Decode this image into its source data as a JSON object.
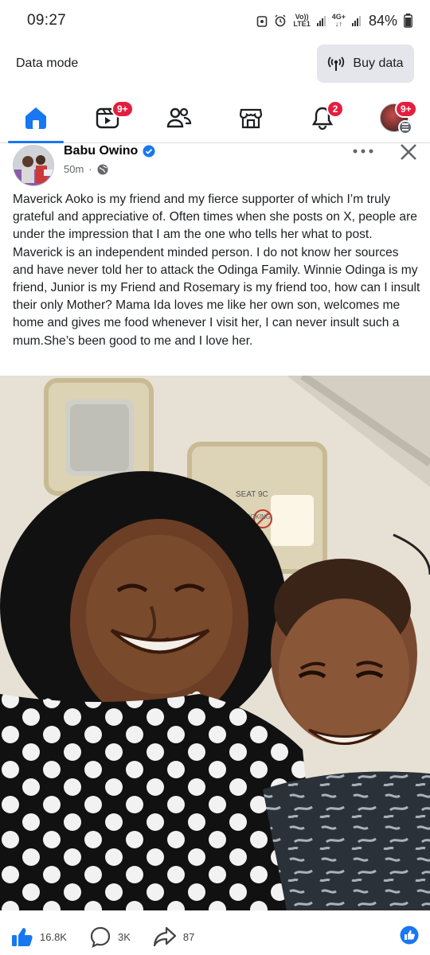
{
  "status_bar": {
    "time": "09:27",
    "volte_label": "Vo))",
    "lte_label": "LTE1",
    "network_label": "4G+",
    "battery_percent": "84%"
  },
  "data_mode": {
    "label": "Data mode",
    "button_label": "Buy data"
  },
  "nav": {
    "tabs": [
      {
        "name": "home",
        "active": true
      },
      {
        "name": "video",
        "badge": "9+"
      },
      {
        "name": "friends"
      },
      {
        "name": "marketplace"
      },
      {
        "name": "notifications",
        "badge": "2"
      },
      {
        "name": "menu",
        "badge": "9+"
      }
    ]
  },
  "post": {
    "author": "Babu Owino",
    "verified": true,
    "time_ago": "50m",
    "audience_icon": "globe-icon",
    "text": "Maverick Aoko is my friend and my fierce supporter of which I’m truly grateful and appreciative of. Often times when she posts on X, people are under the impression that I am the one who tells her what to post. Maverick is an independent minded person. I do not know her sources and have never told her to attack the Odinga Family. Winnie Odinga is my friend, Junior is my Friend and Rosemary is my friend too, how can I insult their only Mother? Mama Ida loves me like her own son, welcomes me home and gives me food whenever I visit her, I can never insult such a mum.She’s been good to me and I love her.",
    "photo_signs": {
      "seat": "SEAT 9C",
      "no_smoking": "NO SMOKING"
    }
  },
  "reactions": {
    "likes": "16.8K",
    "comments": "3K",
    "shares": "87"
  },
  "colors": {
    "accent": "#1877f2",
    "badge": "#e41e3f",
    "button_bg": "#e4e6eb"
  }
}
